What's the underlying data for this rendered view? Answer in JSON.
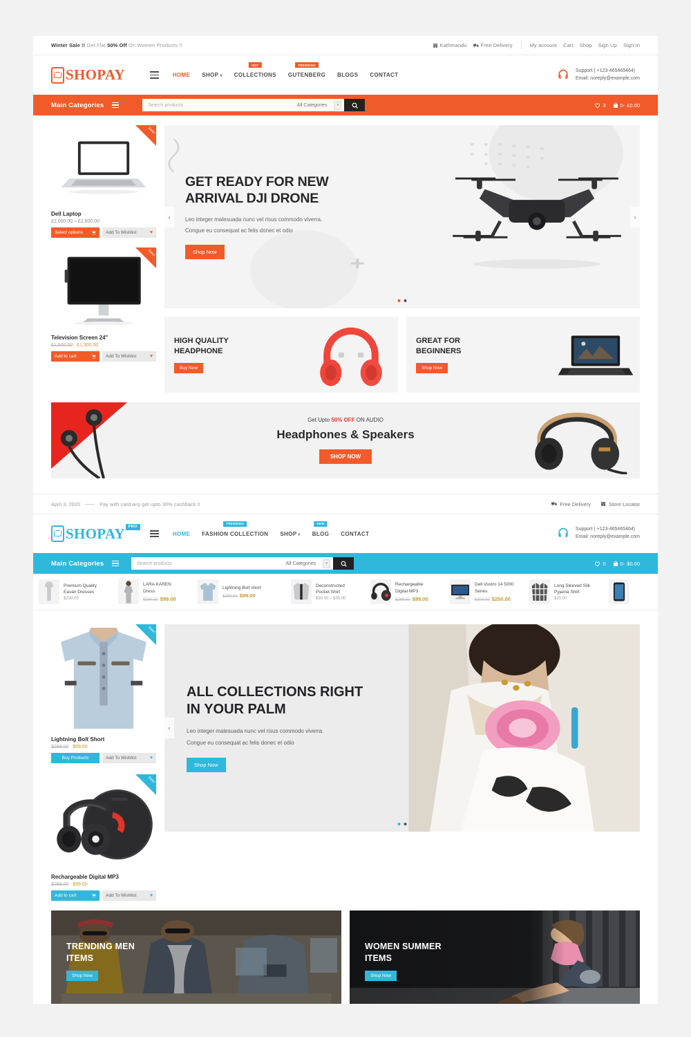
{
  "theme1": {
    "accent": "#f15b2a",
    "topbar": {
      "promo_bold1": "Winter Sale !!",
      "promo_mid": " Get Flat ",
      "promo_bold2": "50% Off",
      "promo_end": " On Women Products !!",
      "location": "Kathmandu",
      "delivery": "Free Delivery",
      "links": [
        "My account",
        "Cart",
        "Shop",
        "Sign Up",
        "Sign In"
      ]
    },
    "brand": {
      "name": "SHOPAY",
      "badge": ""
    },
    "nav": [
      {
        "label": "HOME",
        "active": true,
        "badge": "",
        "caret": false
      },
      {
        "label": "SHOP",
        "active": false,
        "badge": "",
        "caret": true
      },
      {
        "label": "COLLECTIONS",
        "active": false,
        "badge": "HOT",
        "caret": false
      },
      {
        "label": "GUTENBERG",
        "active": false,
        "badge": "TRENDING",
        "caret": false
      },
      {
        "label": "BLOGS",
        "active": false,
        "badge": "",
        "caret": false
      },
      {
        "label": "CONTACT",
        "active": false,
        "badge": "",
        "caret": false
      }
    ],
    "support": {
      "phone": "Support ( +123-465465464)",
      "email": "Email: noreply@example.com"
    },
    "catbar": {
      "title": "Main Categories",
      "search_placeholder": "Search products",
      "category_selected": "All Categories",
      "wishlist_count": "3",
      "cart_count": "0-",
      "cart_total": "£0.00"
    },
    "products": [
      {
        "title": "Dell Laptop",
        "price_range": "£2,000.00 – £2,600.00",
        "old_price": "",
        "new_price": "",
        "cart_label": "Select options",
        "wish_label": "Add To Wishlist",
        "ribbon": "Sale!"
      },
      {
        "title": "Television Screen 24\"",
        "price_range": "",
        "old_price": "£1,500.00",
        "new_price": "£1,300.00",
        "cart_label": "Add to cart",
        "wish_label": "Add To Wishlist",
        "ribbon": "Sale!"
      }
    ],
    "hero": {
      "title_line1": "GET READY FOR NEW",
      "title_line2": "ARRIVAL DJI DRONE",
      "sub_line1": "Leo integer malesuada nunc vel risus commodo viverra.",
      "sub_line2": "Congue eu consequat ac felis donec et odio",
      "button": "Shop Now"
    },
    "promos": [
      {
        "line1": "HIGH QUALITY",
        "line2": "HEADPHONE",
        "button": "Buy Now"
      },
      {
        "line1": "GREAT FOR",
        "line2": "BEGINNERS",
        "button": "Shop Now"
      }
    ],
    "wide_banner": {
      "pre": "Get Upto ",
      "highlight": "50% OFF",
      "post": " ON AUDIO",
      "title": "Headphones & Speakers",
      "button": "SHOP NOW"
    }
  },
  "separator": {
    "date": "April 3, 2020",
    "message": "Pay with card any get upto 30% cashback !!",
    "links": [
      "Free Delivery",
      "Store Locator"
    ]
  },
  "theme2": {
    "accent": "#2fb8dc",
    "brand": {
      "name": "SHOPAY",
      "badge": "PRO"
    },
    "nav": [
      {
        "label": "HOME",
        "active": true,
        "badge": "",
        "caret": false
      },
      {
        "label": "FASHION COLLECTION",
        "active": false,
        "badge": "TRENDING",
        "caret": false
      },
      {
        "label": "SHOP",
        "active": false,
        "badge": "",
        "caret": true
      },
      {
        "label": "BLOG",
        "active": false,
        "badge": "NEW",
        "caret": false
      },
      {
        "label": "CONTACT",
        "active": false,
        "badge": "",
        "caret": false
      }
    ],
    "support": {
      "phone": "Support ( +123-465465464)",
      "email": "Email: noreply@example.com"
    },
    "catbar": {
      "title": "Main Categories",
      "search_placeholder": "Search products",
      "category_selected": "All Categories",
      "wishlist_count": "0",
      "cart_count": "0-",
      "cart_total": "$0.00"
    },
    "strip": [
      {
        "name_line1": "Premium Quality",
        "name_line2": "Eavan Dresses",
        "old": "",
        "new": "",
        "single": "$200.00",
        "img": "dress"
      },
      {
        "name_line1": "LARA KAREN",
        "name_line2": "Dress",
        "old": "$200.00",
        "new": "$99.00",
        "single": "",
        "img": "dress2"
      },
      {
        "name_line1": "Lightning Bolt short",
        "name_line2": "",
        "old": "$289.00",
        "new": "$99.00",
        "single": "",
        "img": "shirt"
      },
      {
        "name_line1": "Deconstructed",
        "name_line2": "Pocket Shirt",
        "old": "",
        "new": "",
        "single": "$30.00 – $35.00",
        "img": "jacket"
      },
      {
        "name_line1": "Rechargeable",
        "name_line2": "Digital MP3",
        "old": "$289.00",
        "new": "$99.00",
        "single": "",
        "img": "headphone"
      },
      {
        "name_line1": "Dell Vostro 14 5000",
        "name_line2": "Series",
        "old": "$300.00",
        "new": "$250.00",
        "single": "",
        "img": "monitor"
      },
      {
        "name_line1": "Long Sleeved Silk",
        "name_line2": "Pyjama Shirt",
        "old": "",
        "new": "",
        "single": "$20.00",
        "img": "plaid"
      },
      {
        "name_line1": "",
        "name_line2": "",
        "old": "",
        "new": "",
        "single": "",
        "img": "phone"
      }
    ],
    "products": [
      {
        "title": "Lightning Bolt Short",
        "old_price": "$289.00",
        "new_price": "$99.00",
        "cart_label": "Buy Products",
        "wish_label": "Add To Wishlist",
        "ribbon": "Sale!"
      },
      {
        "title": "Rechargeable Digital MP3",
        "old_price": "$289.00",
        "new_price": "$99.00",
        "cart_label": "Add to cart",
        "wish_label": "Add To Wishlist",
        "ribbon": "Sale!"
      }
    ],
    "hero": {
      "title_line1": "ALL COLLECTIONS RIGHT",
      "title_line2": "IN YOUR PALM",
      "sub_line1": "Leo integer malesuada nunc vel risus commodo viverra.",
      "sub_line2": "Congue eu consequat ac felis donec et odio",
      "button": "Shop Now"
    },
    "promos": [
      {
        "line1": "TRENDING MEN",
        "line2": "ITEMS",
        "button": "Shop Now"
      },
      {
        "line1": "WOMEN SUMMER",
        "line2": "ITEMS",
        "button": "Shop Now"
      }
    ]
  }
}
